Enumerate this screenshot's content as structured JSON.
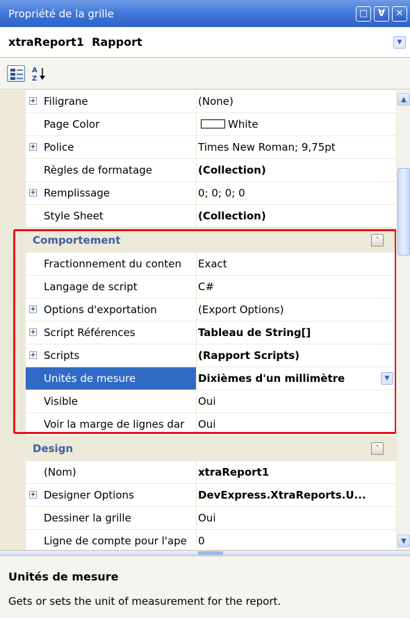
{
  "window": {
    "title": "Propriété de la grille",
    "buttons": [
      "□",
      "Ɐ",
      "✕"
    ]
  },
  "object_selector": {
    "value": "xtraReport1  Rapport"
  },
  "toolbar": {
    "categorized_icon": "categorized-icon",
    "alphabetical_icon": "sort-az-icon",
    "az_glyph": "A↓"
  },
  "sections": [
    {
      "rows": [
        {
          "name": "Filigrane",
          "value": "(None)",
          "expandable": true
        },
        {
          "name": "Page Color",
          "value": "White",
          "swatch": true
        },
        {
          "name": "Police",
          "value": "Times New Roman; 9,75pt",
          "expandable": true
        },
        {
          "name": "Règles de formatage",
          "value": "(Collection)",
          "bold": true
        },
        {
          "name": "Remplissage",
          "value": "0; 0; 0; 0",
          "expandable": true
        },
        {
          "name": "Style Sheet",
          "value": "(Collection)",
          "bold": true
        }
      ]
    },
    {
      "title": "Comportement",
      "rows": [
        {
          "name": "Fractionnement du conten",
          "value": "Exact"
        },
        {
          "name": "Langage de script",
          "value": "C#"
        },
        {
          "name": "Options d'exportation",
          "value": "(Export Options)",
          "expandable": true
        },
        {
          "name": "Script Références",
          "value": "Tableau de String[]",
          "expandable": true,
          "bold": true
        },
        {
          "name": "Scripts",
          "value": "(Rapport Scripts)",
          "expandable": true,
          "bold": true
        },
        {
          "name": "Unités de mesure",
          "value": "Dixièmes d'un millimètre",
          "selected": true
        },
        {
          "name": "Visible",
          "value": "Oui"
        },
        {
          "name": "Voir la marge de lignes dar",
          "value": "Oui"
        }
      ]
    },
    {
      "title": "Design",
      "rows": [
        {
          "name": "(Nom)",
          "value": "xtraReport1",
          "bold": true
        },
        {
          "name": "Designer Options",
          "value": "DevExpress.XtraReports.U...",
          "expandable": true,
          "bold": true
        },
        {
          "name": "Dessiner la grille",
          "value": "Oui"
        },
        {
          "name": "Ligne de compte pour l'ape",
          "value": "0"
        },
        {
          "name": "",
          "value": ""
        }
      ]
    }
  ],
  "collapse_glyph": "˄",
  "description": {
    "title": "Unités de mesure",
    "text": "Gets or sets the unit of measurement for the report."
  },
  "colors": {
    "title_bar": "#3d74d8",
    "selection": "#316ac5",
    "category_text": "#3d5fa1",
    "highlight_border": "#e3141a"
  }
}
